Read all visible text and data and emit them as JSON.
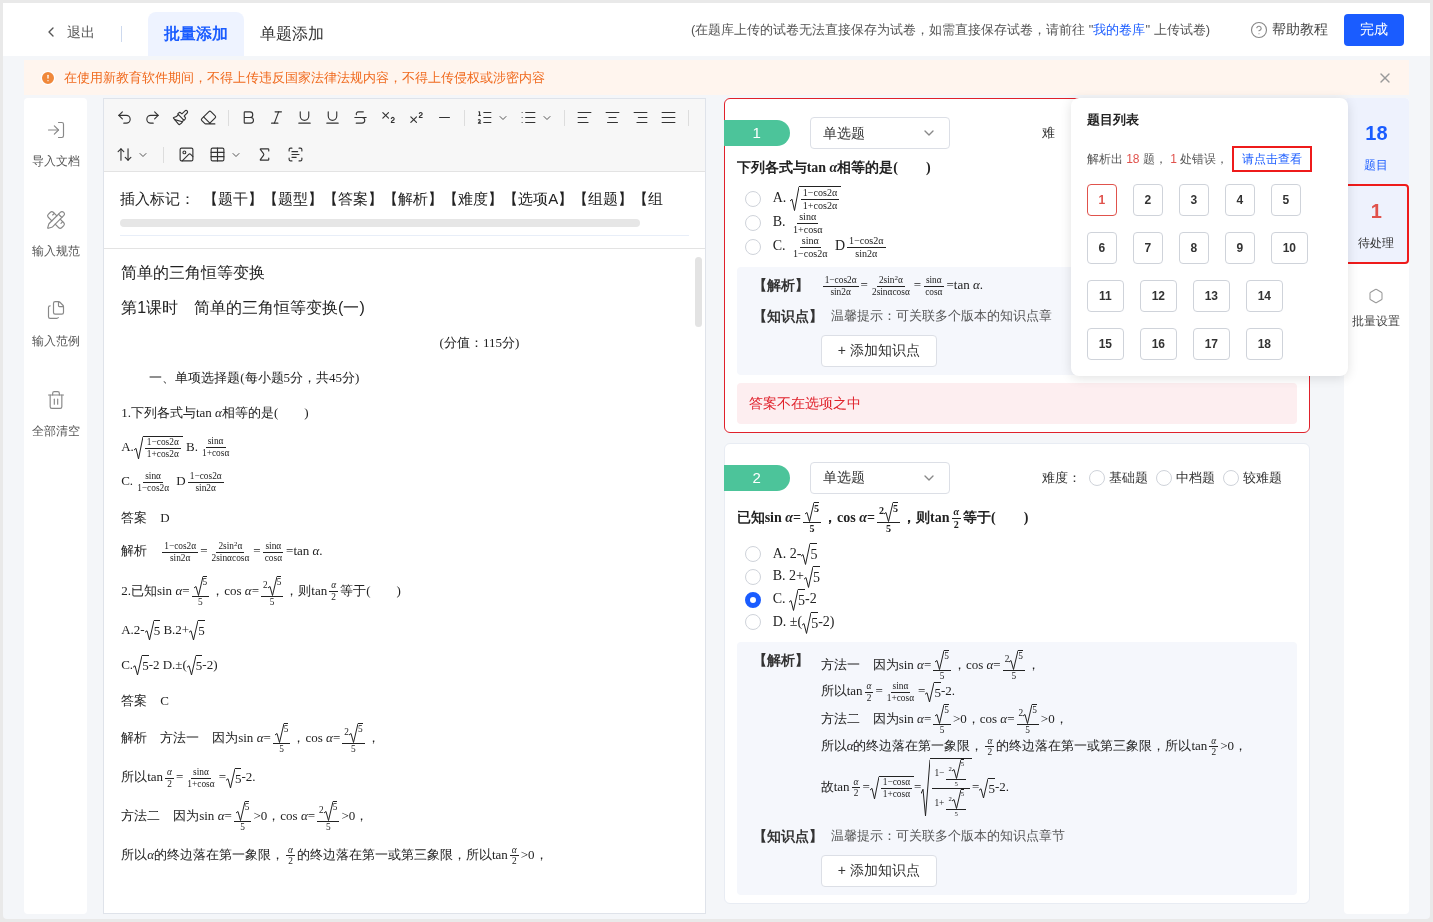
{
  "header": {
    "back": "退出",
    "tabs": [
      {
        "label": "批量添加",
        "selected": true
      },
      {
        "label": "单题添加",
        "selected": false
      }
    ],
    "notice": {
      "before": "(在题库上传的试卷无法直接保存为试卷，如需直接保存试卷，请前往 \"",
      "link": "我的卷库",
      "after": "\" 上传试卷)"
    },
    "help": "帮助教程",
    "done": "完成"
  },
  "warning": "在使用新教育软件期间，不得上传违反国家法律法规内容，不得上传侵权或涉密内容",
  "sidebar": [
    {
      "kind": "import",
      "label": "导入文档"
    },
    {
      "kind": "rules",
      "label": "输入规范"
    },
    {
      "kind": "example",
      "label": "输入范例"
    },
    {
      "kind": "clear",
      "label": "全部清空"
    }
  ],
  "editor": {
    "marks_label": "插入标记：",
    "marks": [
      "【题干】",
      "【题型】",
      "【答案】",
      "【解析】",
      "【难度】",
      "【选项A】",
      "【组题】",
      "【组"
    ],
    "paragraphs": [
      {
        "kind": "title",
        "content": [
          "简单的三角恒等变换"
        ]
      },
      {
        "kind": "title",
        "content": [
          "第1课时　简单的三角恒等变换(一)"
        ]
      },
      {
        "kind": "center",
        "content": [
          "(分值：115分)"
        ]
      },
      {
        "kind": "indent",
        "content": [
          "一、单项选择题(每小题5分，共45分)"
        ]
      },
      {
        "kind": "plain",
        "content": [
          "1.下列各式与tan ",
          "*α*",
          "相等的是(　　)"
        ]
      },
      {
        "kind": "plain",
        "content": [
          "A.",
          {
            "kind": "sqrt",
            "body": [
              {
                "kind": "frac",
                "num": [
                  "1−cos2α"
                ],
                "den": [
                  "1+cos2α"
                ]
              }
            ]
          },
          " B.",
          {
            "kind": "frac",
            "num": [
              "sinα"
            ],
            "den": [
              "1+cosα"
            ]
          }
        ]
      },
      {
        "kind": "plain",
        "content": [
          "C.",
          {
            "kind": "frac",
            "num": [
              "sinα"
            ],
            "den": [
              "1−cos2α"
            ]
          },
          " D",
          {
            "kind": "frac",
            "num": [
              "1−cos2α"
            ],
            "den": [
              "sin2α"
            ]
          }
        ]
      },
      {
        "kind": "plain",
        "content": [
          "答案　D"
        ]
      },
      {
        "kind": "plain",
        "content": [
          "解析　",
          {
            "kind": "frac",
            "num": [
              "1−cos2α"
            ],
            "den": [
              "sin2α"
            ]
          },
          "=",
          {
            "kind": "frac",
            "num": [
              "2sin$^{2}$α"
            ],
            "den": [
              "2sinαcosα"
            ]
          },
          "=",
          {
            "kind": "frac",
            "num": [
              "sinα"
            ],
            "den": [
              "cosα"
            ]
          },
          "=tan *α*."
        ]
      },
      {
        "kind": "plain",
        "content": [
          "2.已知sin *α*=",
          {
            "kind": "frac",
            "num": [
              {
                "kind": "sqrt",
                "body": [
                  "5"
                ]
              }
            ],
            "den": [
              "5"
            ]
          },
          "，cos *α*=",
          {
            "kind": "frac",
            "num": [
              "2",
              {
                "kind": "sqrt",
                "body": [
                  "5"
                ]
              }
            ],
            "den": [
              "5"
            ]
          },
          "，则tan",
          {
            "kind": "frac",
            "num": [
              "*α*"
            ],
            "den": [
              "2"
            ]
          },
          "等于(　　)"
        ]
      },
      {
        "kind": "plain",
        "content": [
          "A.2-",
          {
            "kind": "sqrt",
            "body": [
              "5"
            ]
          },
          " B.2+",
          {
            "kind": "sqrt",
            "body": [
              "5"
            ]
          }
        ]
      },
      {
        "kind": "plain",
        "content": [
          "C.",
          {
            "kind": "sqrt",
            "body": [
              "5"
            ]
          },
          "-2 D.±(",
          {
            "kind": "sqrt",
            "body": [
              "5"
            ]
          },
          "-2)"
        ]
      },
      {
        "kind": "plain",
        "content": [
          "答案　C"
        ]
      },
      {
        "kind": "plain",
        "content": [
          "解析　方法一　因为sin *α*=",
          {
            "kind": "frac",
            "num": [
              {
                "kind": "sqrt",
                "body": [
                  "5"
                ]
              }
            ],
            "den": [
              "5"
            ]
          },
          "，cos *α*=",
          {
            "kind": "frac",
            "num": [
              "2",
              {
                "kind": "sqrt",
                "body": [
                  "5"
                ]
              }
            ],
            "den": [
              "5"
            ]
          },
          "，"
        ]
      },
      {
        "kind": "plain",
        "content": [
          "所以tan",
          {
            "kind": "frac",
            "num": [
              "*α*"
            ],
            "den": [
              "2"
            ]
          },
          "=",
          {
            "kind": "frac",
            "num": [
              "sinα"
            ],
            "den": [
              "1+cosα"
            ]
          },
          "=",
          {
            "kind": "sqrt",
            "body": [
              "5"
            ]
          },
          "-2."
        ]
      },
      {
        "kind": "plain",
        "content": [
          "方法二　因为sin *α*=",
          {
            "kind": "frac",
            "num": [
              {
                "kind": "sqrt",
                "body": [
                  "5"
                ]
              }
            ],
            "den": [
              "5"
            ]
          },
          ">0，cos *α*=",
          {
            "kind": "frac",
            "num": [
              "2",
              {
                "kind": "sqrt",
                "body": [
                  "5"
                ]
              }
            ],
            "den": [
              "5"
            ]
          },
          ">0，"
        ]
      },
      {
        "kind": "plain",
        "content": [
          "所以",
          "*α*",
          "的终边落在第一象限，",
          {
            "kind": "frac",
            "num": [
              "*α*"
            ],
            "den": [
              "2"
            ]
          },
          "的终边落在第一或第三象限，所以tan",
          {
            "kind": "frac",
            "num": [
              "*α*"
            ],
            "den": [
              "2"
            ]
          },
          ">0，"
        ]
      }
    ]
  },
  "questions": [
    {
      "number": "1",
      "type": "单选题",
      "difficulty_label": "难",
      "stem": [
        "下列各式与tan ",
        "*α*",
        "相等的是(　　)"
      ],
      "options": [
        {
          "label": "A.",
          "content": [
            {
              "kind": "sqrt",
              "body": [
                {
                  "kind": "frac",
                  "num": [
                    "1−cos2α"
                  ],
                  "den": [
                    "1+cos2α"
                  ]
                }
              ]
            }
          ],
          "selected": false
        },
        {
          "label": "B.",
          "content": [
            {
              "kind": "frac",
              "num": [
                "sinα"
              ],
              "den": [
                "1+cosα"
              ]
            }
          ],
          "selected": false
        },
        {
          "label": "C.",
          "content": [
            {
              "kind": "frac",
              "num": [
                "sinα"
              ],
              "den": [
                "1−cos2α"
              ]
            },
            " D",
            {
              "kind": "frac",
              "num": [
                "1−cos2α"
              ],
              "den": [
                "sin2α"
              ]
            }
          ],
          "selected": false
        }
      ],
      "analysis_label": "【解析】",
      "analysis": [
        [
          {
            "kind": "frac",
            "num": [
              "1−cos2α"
            ],
            "den": [
              "sin2α"
            ]
          },
          "=",
          {
            "kind": "frac",
            "num": [
              "2sin$^{2}$α"
            ],
            "den": [
              "2sinαcosα"
            ]
          },
          "=",
          {
            "kind": "frac",
            "num": [
              "sinα"
            ],
            "den": [
              "cosα"
            ]
          },
          "=tan *α*."
        ]
      ],
      "knowledge_label": "【知识点】",
      "knowledge_hint": "温馨提示：可关联多个版本的知识点章",
      "add_knowledge": "+ 添加知识点",
      "error": "答案不在选项之中"
    },
    {
      "number": "2",
      "type": "单选题",
      "difficulty_label": "难度：",
      "difficulty_options": [
        {
          "label": "基础题",
          "selected": false
        },
        {
          "label": "中档题",
          "selected": false
        },
        {
          "label": "较难题",
          "selected": false
        }
      ],
      "stem": [
        "已知sin *α*=",
        {
          "kind": "frac",
          "num": [
            {
              "kind": "sqrt",
              "body": [
                "5"
              ]
            }
          ],
          "den": [
            "5"
          ]
        },
        "，cos *α*=",
        {
          "kind": "frac",
          "num": [
            "2",
            {
              "kind": "sqrt",
              "body": [
                "5"
              ]
            }
          ],
          "den": [
            "5"
          ]
        },
        "，则tan",
        {
          "kind": "frac",
          "num": [
            "*α*"
          ],
          "den": [
            "2"
          ]
        },
        "等于(　　)"
      ],
      "options": [
        {
          "label": "A.",
          "content": [
            "2-",
            {
              "kind": "sqrt",
              "body": [
                "5"
              ]
            }
          ],
          "selected": false
        },
        {
          "label": "B.",
          "content": [
            "2+",
            {
              "kind": "sqrt",
              "body": [
                "5"
              ]
            }
          ],
          "selected": false
        },
        {
          "label": "C.",
          "content": [
            {
              "kind": "sqrt",
              "body": [
                "5"
              ]
            },
            "-2"
          ],
          "selected": true
        },
        {
          "label": "D.",
          "content": [
            "±(",
            {
              "kind": "sqrt",
              "body": [
                "5"
              ]
            },
            "-2)"
          ],
          "selected": false
        }
      ],
      "analysis_label": "【解析】",
      "analysis": [
        [
          "方法一　因为sin *α*=",
          {
            "kind": "frac",
            "num": [
              {
                "kind": "sqrt",
                "body": [
                  "5"
                ]
              }
            ],
            "den": [
              "5"
            ]
          },
          "，cos *α*=",
          {
            "kind": "frac",
            "num": [
              "2",
              {
                "kind": "sqrt",
                "body": [
                  "5"
                ]
              }
            ],
            "den": [
              "5"
            ]
          },
          "，"
        ],
        [
          "所以tan",
          {
            "kind": "frac",
            "num": [
              "*α*"
            ],
            "den": [
              "2"
            ]
          },
          "=",
          {
            "kind": "frac",
            "num": [
              "sinα"
            ],
            "den": [
              "1+cosα"
            ]
          },
          "=",
          {
            "kind": "sqrt",
            "body": [
              "5"
            ]
          },
          "-2."
        ],
        [
          "方法二　因为sin *α*=",
          {
            "kind": "frac",
            "num": [
              {
                "kind": "sqrt",
                "body": [
                  "5"
                ]
              }
            ],
            "den": [
              "5"
            ]
          },
          ">0，cos *α*=",
          {
            "kind": "frac",
            "num": [
              "2",
              {
                "kind": "sqrt",
                "body": [
                  "5"
                ]
              }
            ],
            "den": [
              "5"
            ]
          },
          ">0，"
        ],
        [
          "所以",
          "*α*",
          "的终边落在第一象限，",
          {
            "kind": "frac",
            "num": [
              "*α*"
            ],
            "den": [
              "2"
            ]
          },
          "的终边落在第一或第三象限，所以tan",
          {
            "kind": "frac",
            "num": [
              "*α*"
            ],
            "den": [
              "2"
            ]
          },
          ">0，"
        ],
        [
          "故tan",
          {
            "kind": "frac",
            "num": [
              "*α*"
            ],
            "den": [
              "2"
            ]
          },
          "=",
          {
            "kind": "sqrt",
            "body": [
              {
                "kind": "frac",
                "num": [
                  "1−cosα"
                ],
                "den": [
                  "1+cosα"
                ]
              }
            ]
          },
          "=",
          {
            "kind": "sqrt",
            "body": [
              {
                "kind": "frac",
                "num": [
                  "1−",
                  {
                    "kind": "frac",
                    "num": [
                      "2",
                      {
                        "kind": "sqrt",
                        "body": [
                          "5"
                        ]
                      }
                    ],
                    "den": [
                      "5"
                    ]
                  }
                ],
                "den": [
                  "1+",
                  {
                    "kind": "frac",
                    "num": [
                      "2",
                      {
                        "kind": "sqrt",
                        "body": [
                          "5"
                        ]
                      }
                    ],
                    "den": [
                      "5"
                    ]
                  }
                ]
              }
            ]
          },
          "=",
          {
            "kind": "sqrt",
            "body": [
              "5"
            ]
          },
          "-2."
        ]
      ],
      "knowledge_label": "【知识点】",
      "knowledge_hint": "温馨提示：可关联多个版本的知识点章节",
      "add_knowledge": "+ 添加知识点"
    }
  ],
  "question_list": {
    "title": "题目列表",
    "parsed_prefix": "解析出",
    "parsed_count": "18",
    "parsed_suffix": "题，",
    "error_count": "1",
    "error_suffix": "处错误，",
    "view_link": "请点击查看",
    "items": [
      {
        "label": "1",
        "error": true
      },
      {
        "label": "2",
        "error": false
      },
      {
        "label": "3",
        "error": false
      },
      {
        "label": "4",
        "error": false
      },
      {
        "label": "5",
        "error": false
      },
      {
        "label": "6",
        "error": false
      },
      {
        "label": "7",
        "error": false
      },
      {
        "label": "8",
        "error": false
      },
      {
        "label": "9",
        "error": false
      },
      {
        "label": "10",
        "error": false
      },
      {
        "label": "11",
        "error": false
      },
      {
        "label": "12",
        "error": false
      },
      {
        "label": "13",
        "error": false
      },
      {
        "label": "14",
        "error": false
      },
      {
        "label": "15",
        "error": false
      },
      {
        "label": "16",
        "error": false
      },
      {
        "label": "17",
        "error": false
      },
      {
        "label": "18",
        "error": false
      }
    ]
  },
  "rail": [
    {
      "kind": "count",
      "count": "18",
      "label": "题目",
      "highlighted": false
    },
    {
      "kind": "count",
      "count": "1",
      "label": "待处理",
      "highlighted": true
    },
    {
      "kind": "settings",
      "label": "批量设置"
    }
  ]
}
